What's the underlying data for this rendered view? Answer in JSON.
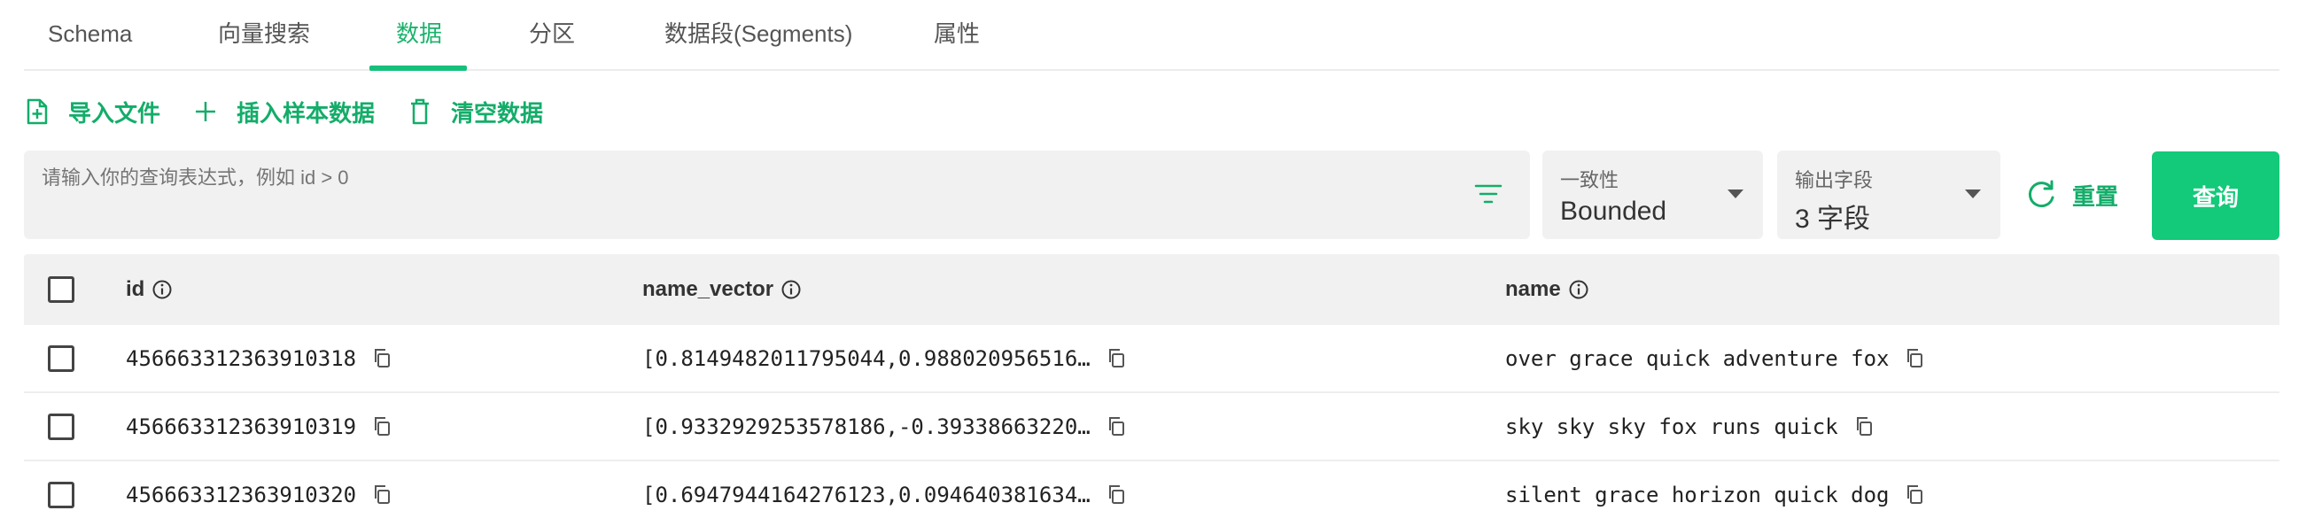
{
  "tabs": [
    {
      "label": "Schema"
    },
    {
      "label": "向量搜索"
    },
    {
      "label": "数据"
    },
    {
      "label": "分区"
    },
    {
      "label": "数据段(Segments)"
    },
    {
      "label": "属性"
    }
  ],
  "active_tab": "数据",
  "toolbar": {
    "import_label": "导入文件",
    "insert_label": "插入样本数据",
    "clear_label": "清空数据"
  },
  "query": {
    "placeholder": "请输入你的查询表达式，例如 id > 0",
    "consistency_label": "一致性",
    "consistency_value": "Bounded",
    "output_label": "输出字段",
    "output_value": "3 字段",
    "reset_label": "重置",
    "query_label": "查询"
  },
  "table": {
    "columns": [
      "id",
      "name_vector",
      "name"
    ],
    "rows": [
      {
        "id": "456663312363910318",
        "name_vector": "[0.8149482011795044,0.988020956516…",
        "name": "over grace quick adventure fox"
      },
      {
        "id": "456663312363910319",
        "name_vector": "[0.9332929253578186,-0.39338663220…",
        "name": "sky sky sky fox runs quick"
      },
      {
        "id": "456663312363910320",
        "name_vector": "[0.6947944164276123,0.094640381634…",
        "name": "silent grace horizon quick dog"
      }
    ]
  },
  "colors": {
    "accent": "#13ad69",
    "button_bg": "#13c97a",
    "panel_bg": "#f1f1f1"
  }
}
